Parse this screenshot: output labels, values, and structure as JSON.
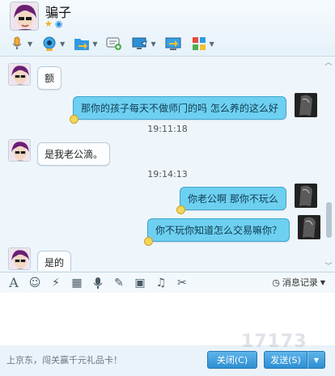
{
  "header": {
    "contact_name": "骗子",
    "status_icons": [
      "star-icon",
      "qq-icon"
    ]
  },
  "toolbar": {
    "items": [
      "microphone-icon",
      "webcam-icon",
      "file-transfer-icon",
      "message-icon",
      "screen-share-icon",
      "remote-assist-icon",
      "apps-icon"
    ]
  },
  "messages": [
    {
      "side": "left",
      "text": "额"
    },
    {
      "side": "right",
      "text": "那你的孩子每天不做师门的吗  怎么养的这么好"
    },
    {
      "side": "left",
      "text": "是我老公滴。"
    },
    {
      "side": "right",
      "text": "你老公啊  那你不玩么"
    },
    {
      "side": "right",
      "text": "你不玩你知道怎么交易嘛你？"
    },
    {
      "side": "left",
      "text": "是的"
    }
  ],
  "timestamps": [
    "19:11:18",
    "19:14:13"
  ],
  "input_toolbar": {
    "history_label": "消息记录"
  },
  "bottom": {
    "ad_text": "上京东，闯关赢千元礼品卡！",
    "close_label": "关闭(C)",
    "send_label": "发送(S)",
    "watermark": "17173"
  },
  "colors": {
    "my_bubble": "#6ed0f1",
    "button": "#2d8fd2"
  }
}
